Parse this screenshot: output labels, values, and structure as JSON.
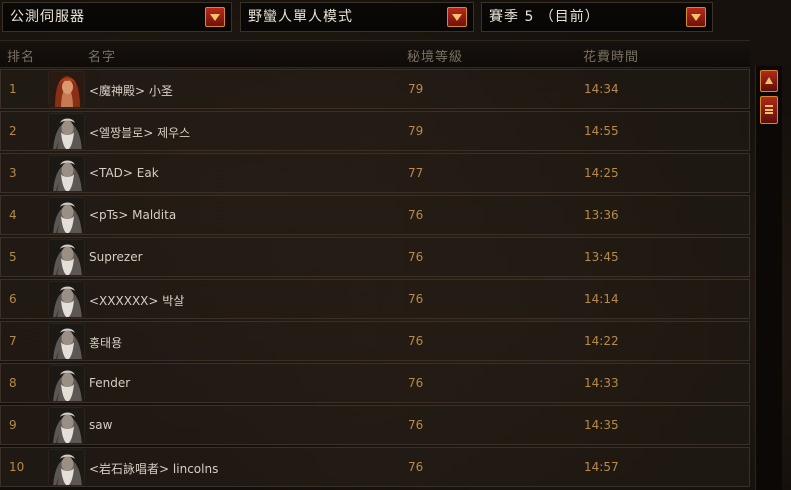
{
  "filters": {
    "server": "公測伺服器",
    "mode": "野蠻人單人模式",
    "season": "賽季 5 （目前）"
  },
  "header": {
    "rank": "排名",
    "name": "名字",
    "level": "秘境等級",
    "time": "花費時間"
  },
  "rows": [
    {
      "rank": "1",
      "name": "<魔神殿> 小圣",
      "level": "79",
      "time": "14:34",
      "portrait": "female-barbarian-icon"
    },
    {
      "rank": "2",
      "name": "<엘짱블로> 제우스",
      "level": "79",
      "time": "14:55",
      "portrait": "male-barbarian-icon"
    },
    {
      "rank": "3",
      "name": "<TAD> Eak",
      "level": "77",
      "time": "14:25",
      "portrait": "male-barbarian-icon"
    },
    {
      "rank": "4",
      "name": "<pTs> Maldita",
      "level": "76",
      "time": "13:36",
      "portrait": "male-barbarian-icon"
    },
    {
      "rank": "5",
      "name": "Suprezer",
      "level": "76",
      "time": "13:45",
      "portrait": "male-barbarian-icon"
    },
    {
      "rank": "6",
      "name": "<XXXXXX> 박살",
      "level": "76",
      "time": "14:14",
      "portrait": "male-barbarian-icon"
    },
    {
      "rank": "7",
      "name": "홍태용",
      "level": "76",
      "time": "14:22",
      "portrait": "male-barbarian-icon"
    },
    {
      "rank": "8",
      "name": "Fender",
      "level": "76",
      "time": "14:33",
      "portrait": "male-barbarian-icon"
    },
    {
      "rank": "9",
      "name": "saw",
      "level": "76",
      "time": "14:35",
      "portrait": "male-barbarian-icon"
    },
    {
      "rank": "10",
      "name": "<岩石詠唱者> lincolns",
      "level": "76",
      "time": "14:57",
      "portrait": "male-barbarian-icon"
    }
  ]
}
